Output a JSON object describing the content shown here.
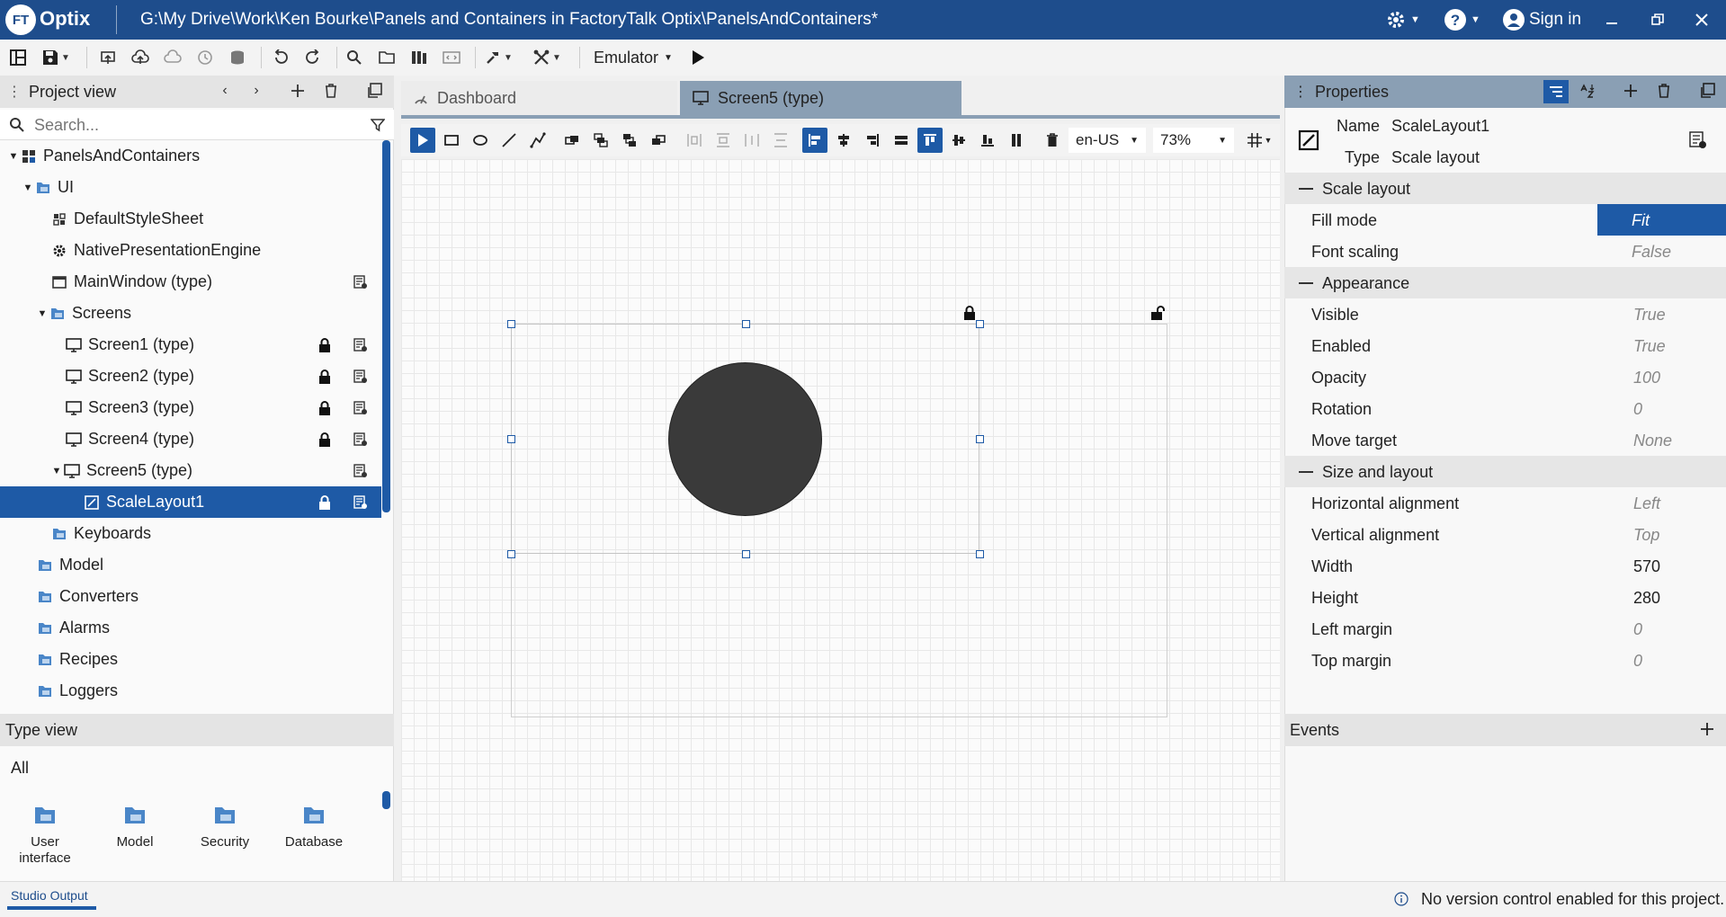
{
  "app": {
    "logo_text": "FT",
    "name": "Optix",
    "path": "G:\\My Drive\\Work\\Ken Bourke\\Panels and Containers in FactoryTalk Optix\\PanelsAndContainers*",
    "sign_in": "Sign in",
    "accent": "#1e4d8c",
    "selection": "#1e5aa6"
  },
  "toolbar": {
    "emulator_label": "Emulator"
  },
  "project_view": {
    "title": "Project view",
    "search_placeholder": "Search...",
    "tree": [
      {
        "label": "PanelsAndContainers"
      },
      {
        "label": "UI"
      },
      {
        "label": "DefaultStyleSheet"
      },
      {
        "label": "NativePresentationEngine"
      },
      {
        "label": "MainWindow (type)"
      },
      {
        "label": "Screens"
      },
      {
        "label": "Screen1 (type)"
      },
      {
        "label": "Screen2 (type)"
      },
      {
        "label": "Screen3 (type)"
      },
      {
        "label": "Screen4 (type)"
      },
      {
        "label": "Screen5 (type)"
      },
      {
        "label": "ScaleLayout1"
      },
      {
        "label": "Keyboards"
      },
      {
        "label": "Model"
      },
      {
        "label": "Converters"
      },
      {
        "label": "Alarms"
      },
      {
        "label": "Recipes"
      },
      {
        "label": "Loggers"
      }
    ]
  },
  "type_view": {
    "title": "Type view",
    "filter": "All",
    "items": [
      {
        "label": "User interface"
      },
      {
        "label": "Model"
      },
      {
        "label": "Security"
      },
      {
        "label": "Database"
      }
    ]
  },
  "tabs": [
    {
      "label": "Dashboard"
    },
    {
      "label": "Screen5 (type)"
    }
  ],
  "editor": {
    "locale": "en-US",
    "zoom": "73%"
  },
  "properties": {
    "title": "Properties",
    "name_label": "Name",
    "name_value": "ScaleLayout1",
    "type_label": "Type",
    "type_value": "Scale layout",
    "sections": [
      {
        "title": "Scale layout",
        "rows": [
          {
            "label": "Fill mode",
            "value": "Fit"
          },
          {
            "label": "Font scaling",
            "value": "False"
          }
        ]
      },
      {
        "title": "Appearance",
        "rows": [
          {
            "label": "Visible",
            "value": "True"
          },
          {
            "label": "Enabled",
            "value": "True"
          },
          {
            "label": "Opacity",
            "value": "100"
          },
          {
            "label": "Rotation",
            "value": "0"
          },
          {
            "label": "Move target",
            "value": "None"
          }
        ]
      },
      {
        "title": "Size and layout",
        "rows": [
          {
            "label": "Horizontal alignment",
            "value": "Left"
          },
          {
            "label": "Vertical alignment",
            "value": "Top"
          },
          {
            "label": "Width",
            "value": "570"
          },
          {
            "label": "Height",
            "value": "280"
          },
          {
            "label": "Left margin",
            "value": "0"
          },
          {
            "label": "Top margin",
            "value": "0"
          }
        ]
      }
    ],
    "events_title": "Events"
  },
  "status": {
    "output_tab": "Studio Output",
    "message": "No version control enabled for this project."
  }
}
